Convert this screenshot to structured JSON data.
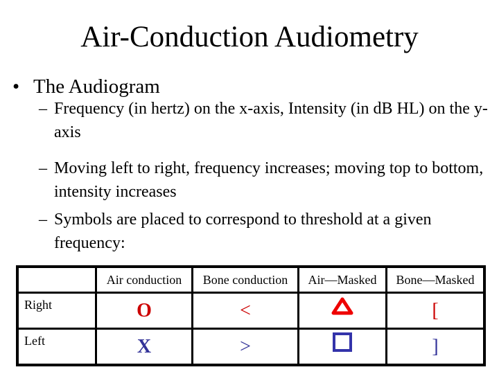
{
  "slide": {
    "title": "Air-Conduction Audiometry",
    "bullet": "The Audiogram",
    "bullet_marker": "•",
    "sub_marker": "–",
    "sub_bullets": [
      "Frequency (in hertz) on the x-axis, Intensity (in dB HL) on the y-axis",
      "Moving left to right, frequency increases; moving top to bottom, intensity increases",
      "Symbols are placed to correspond to threshold at a given frequency:"
    ]
  },
  "legend_table": {
    "headers": [
      "",
      "Air conduction",
      "Bone conduction",
      "Air—Masked",
      "Bone—Masked"
    ],
    "rows": [
      {
        "label": "Right",
        "air": "O",
        "bone": "<",
        "air_masked": "triangle",
        "bone_masked": "["
      },
      {
        "label": "Left",
        "air": "X",
        "bone": ">",
        "air_masked": "square",
        "bone_masked": "]"
      }
    ]
  },
  "colors": {
    "right_ear": "#cc0000",
    "left_ear": "#333399",
    "triangle": "#ee0000",
    "square": "#3333aa"
  }
}
